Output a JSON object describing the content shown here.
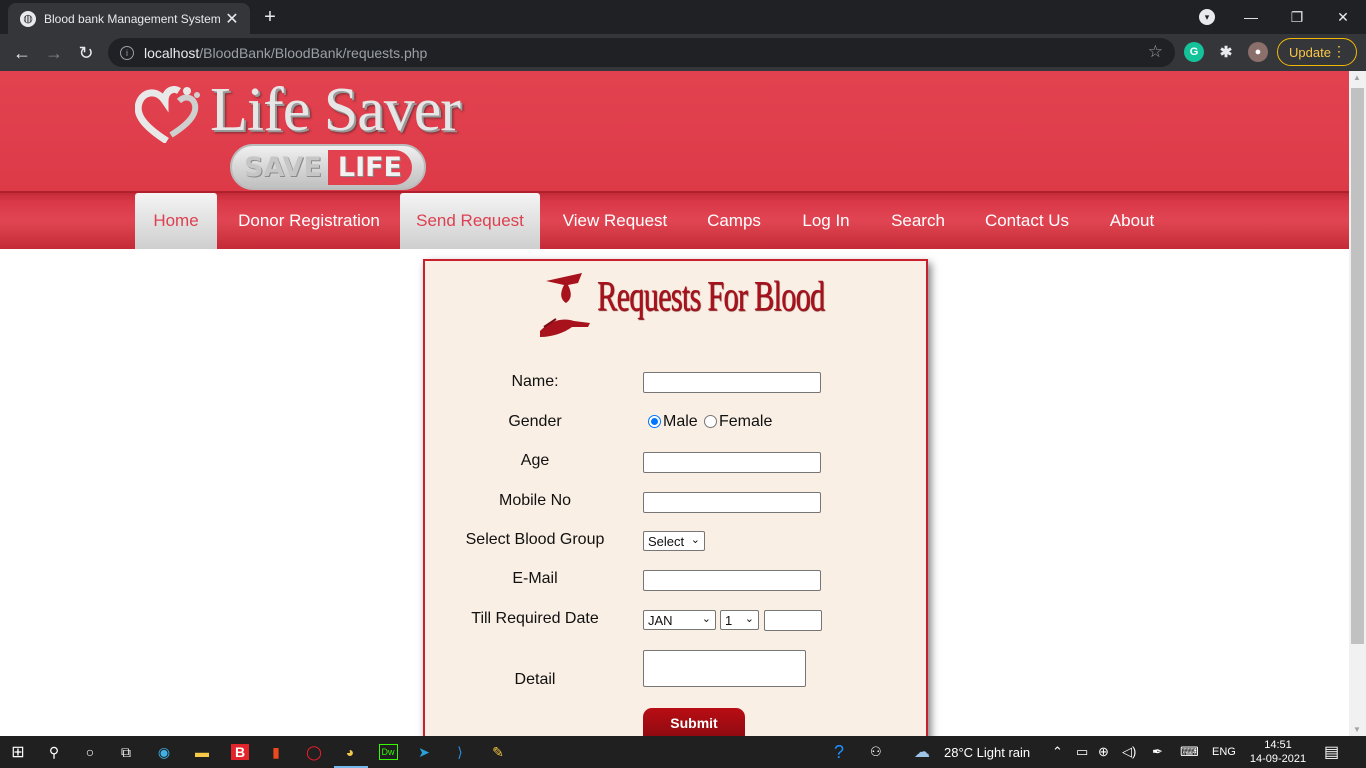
{
  "browser": {
    "tab_title": "Blood bank Management System",
    "url_host": "localhost",
    "url_path": "/BloodBank/BloodBank/requests.php",
    "update_label": "Update"
  },
  "site": {
    "logo_title": "Life Saver",
    "logo_badge_left": "SAVE",
    "logo_badge_right": "LIFE",
    "nav": [
      {
        "label": "Home",
        "active": true
      },
      {
        "label": "Donor Registration",
        "active": false
      },
      {
        "label": "Send Request",
        "active": true
      },
      {
        "label": "View Request",
        "active": false
      },
      {
        "label": "Camps",
        "active": false
      },
      {
        "label": "Log In",
        "active": false
      },
      {
        "label": "Search",
        "active": false
      },
      {
        "label": "Contact Us",
        "active": false
      },
      {
        "label": "About",
        "active": false
      }
    ]
  },
  "form": {
    "title": "Requests For Blood",
    "labels": {
      "name": "Name:",
      "gender": "Gender",
      "age": "Age",
      "mobile": "Mobile No",
      "blood_group": "Select Blood Group",
      "email": "E-Mail",
      "till_date": "Till Required Date",
      "detail": "Detail"
    },
    "gender_options": [
      "Male",
      "Female"
    ],
    "gender_selected": "Male",
    "blood_group_value": "Select",
    "month_value": "JAN",
    "day_value": "1",
    "submit_label": "Submit"
  },
  "taskbar": {
    "weather": "28°C  Light rain",
    "language": "ENG",
    "time": "14:51",
    "date": "14-09-2021"
  },
  "colors": {
    "brand_red": "#e2424f",
    "title_red": "#a8121d",
    "form_bg": "#f9efe4"
  }
}
